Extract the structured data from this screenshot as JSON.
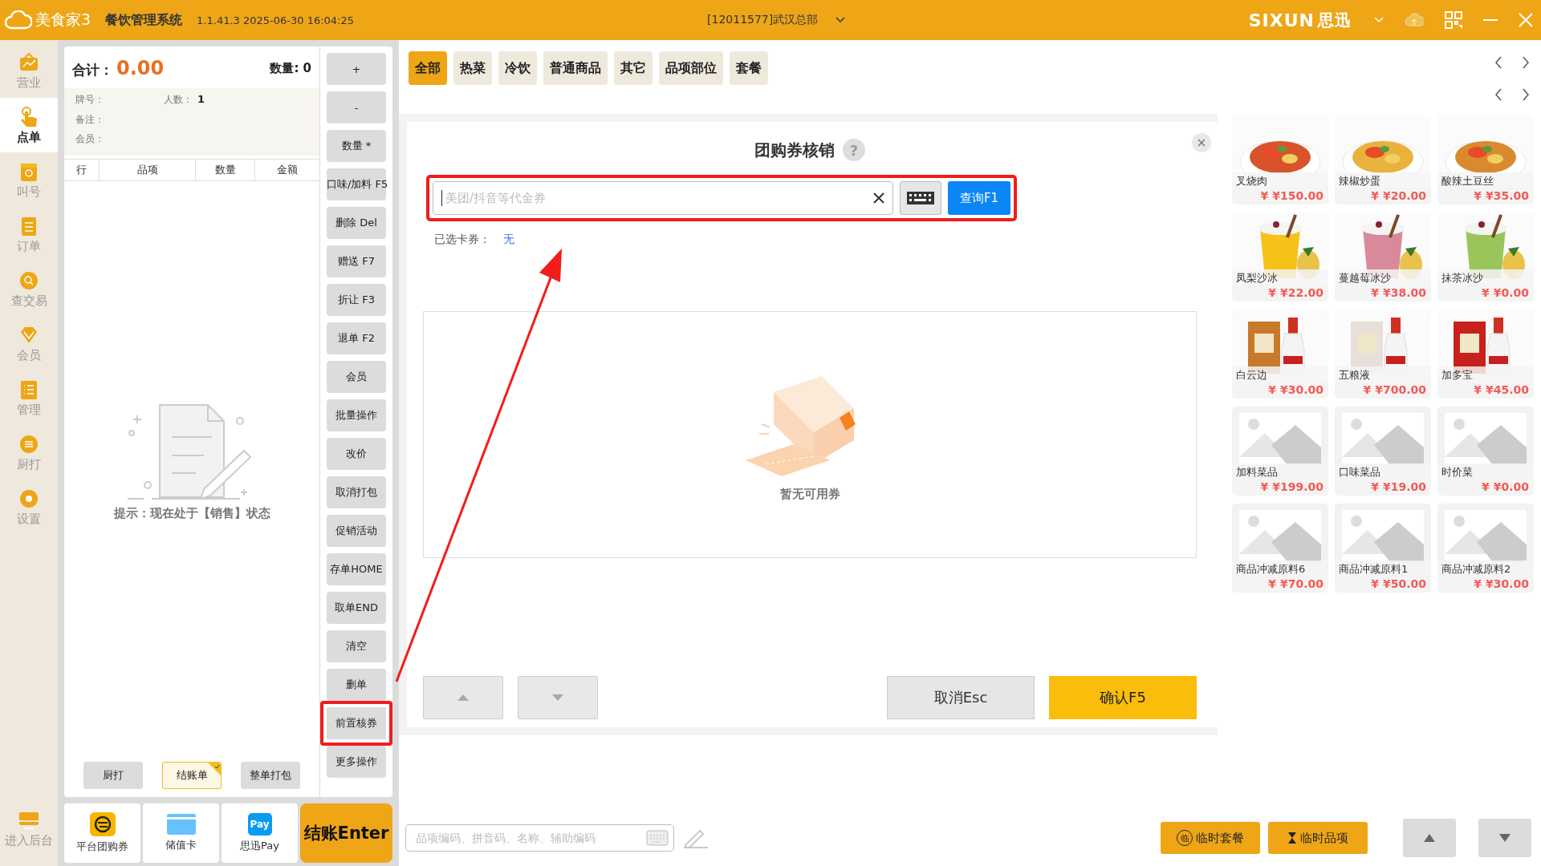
{
  "titlebar": {
    "app_name": "美食家3",
    "system": "餐饮管理系统",
    "version": "1.1.41.3 2025-06-30 16:04:25",
    "store": "[12011577]武汉总部",
    "brand": "SIXUN",
    "brand_cn": "思迅"
  },
  "nav": [
    {
      "label": "营业",
      "selected": false
    },
    {
      "label": "点单",
      "selected": true
    },
    {
      "label": "叫号",
      "selected": false
    },
    {
      "label": "订单",
      "selected": false
    },
    {
      "label": "查交易",
      "selected": false
    },
    {
      "label": "会员",
      "selected": false
    },
    {
      "label": "管理",
      "selected": false
    },
    {
      "label": "厨打",
      "selected": false
    },
    {
      "label": "设置",
      "selected": false
    }
  ],
  "backend": {
    "label": "进入后台"
  },
  "order": {
    "total_label": "合计：",
    "total": "0.00",
    "qty_label": "数量:",
    "qty": "0",
    "plate_label": "牌号：",
    "people_label": "人数：",
    "people": "1",
    "remark_label": "备注：",
    "member_label": "会员："
  },
  "columns": [
    "行",
    "品项",
    "数量",
    "金额"
  ],
  "empty_hint": "提示：现在处于【销售】状态",
  "actions": [
    {
      "label": "+",
      "highlighted": false
    },
    {
      "label": "-",
      "highlighted": false
    },
    {
      "label": "数量 *",
      "highlighted": false
    },
    {
      "label": "口味/加料 F5",
      "highlighted": false
    },
    {
      "label": "删除 Del",
      "highlighted": false
    },
    {
      "label": "赠送 F7",
      "highlighted": false
    },
    {
      "label": "折让 F3",
      "highlighted": false
    },
    {
      "label": "退单 F2",
      "highlighted": false
    },
    {
      "label": "会员",
      "highlighted": false
    },
    {
      "label": "批量操作",
      "highlighted": false
    },
    {
      "label": "改价",
      "highlighted": false
    },
    {
      "label": "取消打包",
      "highlighted": false
    },
    {
      "label": "促销活动",
      "highlighted": false
    },
    {
      "label": "存单HOME",
      "highlighted": false
    },
    {
      "label": "取单END",
      "highlighted": false
    },
    {
      "label": "清空",
      "highlighted": false
    },
    {
      "label": "删单",
      "highlighted": false
    },
    {
      "label": "前置核券",
      "highlighted": true
    },
    {
      "label": "更多操作",
      "highlighted": false
    }
  ],
  "print_options": [
    {
      "label": "厨打",
      "checked": false
    },
    {
      "label": "结账单",
      "checked": true
    },
    {
      "label": "整单打包",
      "checked": false
    }
  ],
  "payments": [
    {
      "label": "平台团购券",
      "kind": "voucher"
    },
    {
      "label": "储值卡",
      "kind": "card"
    },
    {
      "label": "思迅Pay",
      "kind": "pay",
      "icon_text": "Pay"
    }
  ],
  "checkout": "结账Enter",
  "categories": [
    {
      "label": "全部",
      "selected": true
    },
    {
      "label": "热菜",
      "selected": false
    },
    {
      "label": "冷饮",
      "selected": false
    },
    {
      "label": "普通商品",
      "selected": false
    },
    {
      "label": "其它",
      "selected": false
    },
    {
      "label": "品项部位",
      "selected": false
    },
    {
      "label": "套餐",
      "selected": false
    }
  ],
  "dialog": {
    "title": "团购券核销",
    "help": "?",
    "placeholder": "美团/抖音等代金券",
    "query": "查询F1",
    "input_highlighted": true,
    "selected_label": "已选卡券：",
    "selected_value": "无",
    "empty": "暂无可用券",
    "cancel": "取消Esc",
    "confirm": "确认F5"
  },
  "products": [
    {
      "name": "叉烧肉",
      "price": "¥ ¥150.00",
      "kind": "picture"
    },
    {
      "name": "辣椒炒蛋",
      "price": "¥ ¥20.00",
      "kind": "picture"
    },
    {
      "name": "酸辣土豆丝",
      "price": "¥ ¥35.00",
      "kind": "picture"
    },
    {
      "name": "凤梨沙冰",
      "price": "¥ ¥22.00",
      "kind": "picture"
    },
    {
      "name": "蔓越莓冰沙",
      "price": "¥ ¥38.00",
      "kind": "picture"
    },
    {
      "name": "抹茶冰沙",
      "price": "¥ ¥0.00",
      "kind": "picture"
    },
    {
      "name": "白云边",
      "price": "¥ ¥30.00",
      "kind": "picture"
    },
    {
      "name": "五粮液",
      "price": "¥ ¥700.00",
      "kind": "picture"
    },
    {
      "name": "加多宝",
      "price": "¥ ¥45.00",
      "kind": "picture"
    },
    {
      "name": "加料菜品",
      "price": "¥ ¥199.00",
      "kind": "placeholder"
    },
    {
      "name": "口味菜品",
      "price": "¥ ¥19.00",
      "kind": "placeholder"
    },
    {
      "name": "时价菜",
      "price": "¥ ¥0.00",
      "kind": "placeholder"
    },
    {
      "name": "商品冲减原料6",
      "price": "¥ ¥70.00",
      "kind": "placeholder"
    },
    {
      "name": "商品冲减原料1",
      "price": "¥ ¥50.00",
      "kind": "placeholder"
    },
    {
      "name": "商品冲减原料2",
      "price": "¥ ¥30.00",
      "kind": "placeholder"
    }
  ],
  "bottom": {
    "search_placeholder": "品项编码、拼音码、名称、辅助编码",
    "temp_set": "临时套餐",
    "temp_set_icon": "临",
    "temp_item": "临时品项"
  }
}
